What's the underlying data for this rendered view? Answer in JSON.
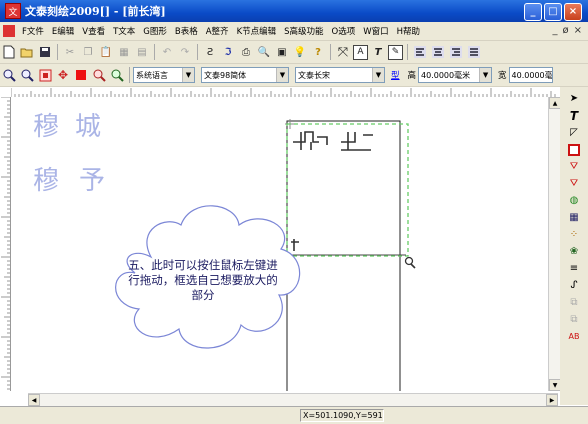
{
  "window": {
    "title": "文泰刻绘2009[] - [前长湾]",
    "app_icon": "app-icon",
    "controls": [
      "minimize",
      "maximize",
      "close"
    ]
  },
  "menubar": {
    "items": [
      {
        "label": "F文件"
      },
      {
        "label": "E编辑"
      },
      {
        "label": "V查看"
      },
      {
        "label": "T文本"
      },
      {
        "label": "G图形"
      },
      {
        "label": "B表格"
      },
      {
        "label": "A整齐"
      },
      {
        "label": "K节点编辑"
      },
      {
        "label": "S高级功能"
      },
      {
        "label": "O选项"
      },
      {
        "label": "W窗口"
      },
      {
        "label": "H帮助"
      }
    ],
    "mdi_controls": [
      "_",
      "ø",
      "×"
    ]
  },
  "toolbar1": {
    "text_buttons": [
      "T",
      "A"
    ]
  },
  "toolbar2": {
    "language_combo": "系统语言",
    "font_combo": "文泰98简体",
    "font2_combo": "文泰长宋",
    "type_label": "型",
    "height_label": "高",
    "height_value": "40.0000毫米",
    "width_label": "宽",
    "width_value": "40.0000毫"
  },
  "canvas": {
    "glyph_chars_top": [
      "穆",
      "城"
    ],
    "glyph_chars_bottom": [
      "穆",
      "予"
    ],
    "callout_text": "五、此时可以按住鼠标左键进行拖动，框选自己想要放大的部分",
    "selection_color": "#66cc66",
    "glyph_color": "#aab4e6",
    "cloud_stroke": "#7b86d6"
  },
  "status": {
    "coords": "X=501.1090,Y=591.("
  }
}
